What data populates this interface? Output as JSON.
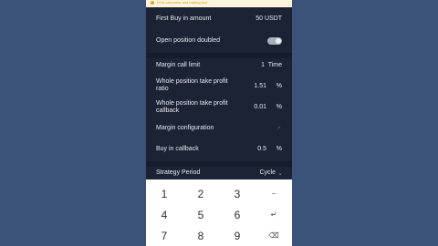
{
  "banner": {
    "text": "DCA calculator and trading tool"
  },
  "rows": {
    "first_buy": {
      "label": "First Buy in amount",
      "value": "50",
      "unit": "USDT"
    },
    "open_doubled": {
      "label": "Open position doubled",
      "toggle_on": false
    },
    "margin_call": {
      "label": "Margin call limit",
      "value": "1",
      "unit": "Time"
    },
    "take_profit_ratio": {
      "label": "Whole position take profit ratio",
      "value": "1.51",
      "unit": "%"
    },
    "take_profit_callback": {
      "label": "Whole position take profit callback",
      "value": "0.01",
      "unit": "%"
    },
    "margin_config": {
      "label": "Margin configuration"
    },
    "buy_callback": {
      "label": "Buy in callback",
      "value": "0.5",
      "unit": "%"
    },
    "strategy_period": {
      "label": "Strategy Period",
      "value": "Cycle"
    }
  },
  "keyboard": {
    "keys": [
      "1",
      "2",
      "3",
      "−",
      "4",
      "5",
      "6",
      "↵",
      "7",
      "8",
      "9",
      "⌫"
    ]
  },
  "colors": {
    "background": "#3b5378",
    "panel": "#1b2335",
    "separator": "#151c2b",
    "keyboard": "#ffffff"
  }
}
